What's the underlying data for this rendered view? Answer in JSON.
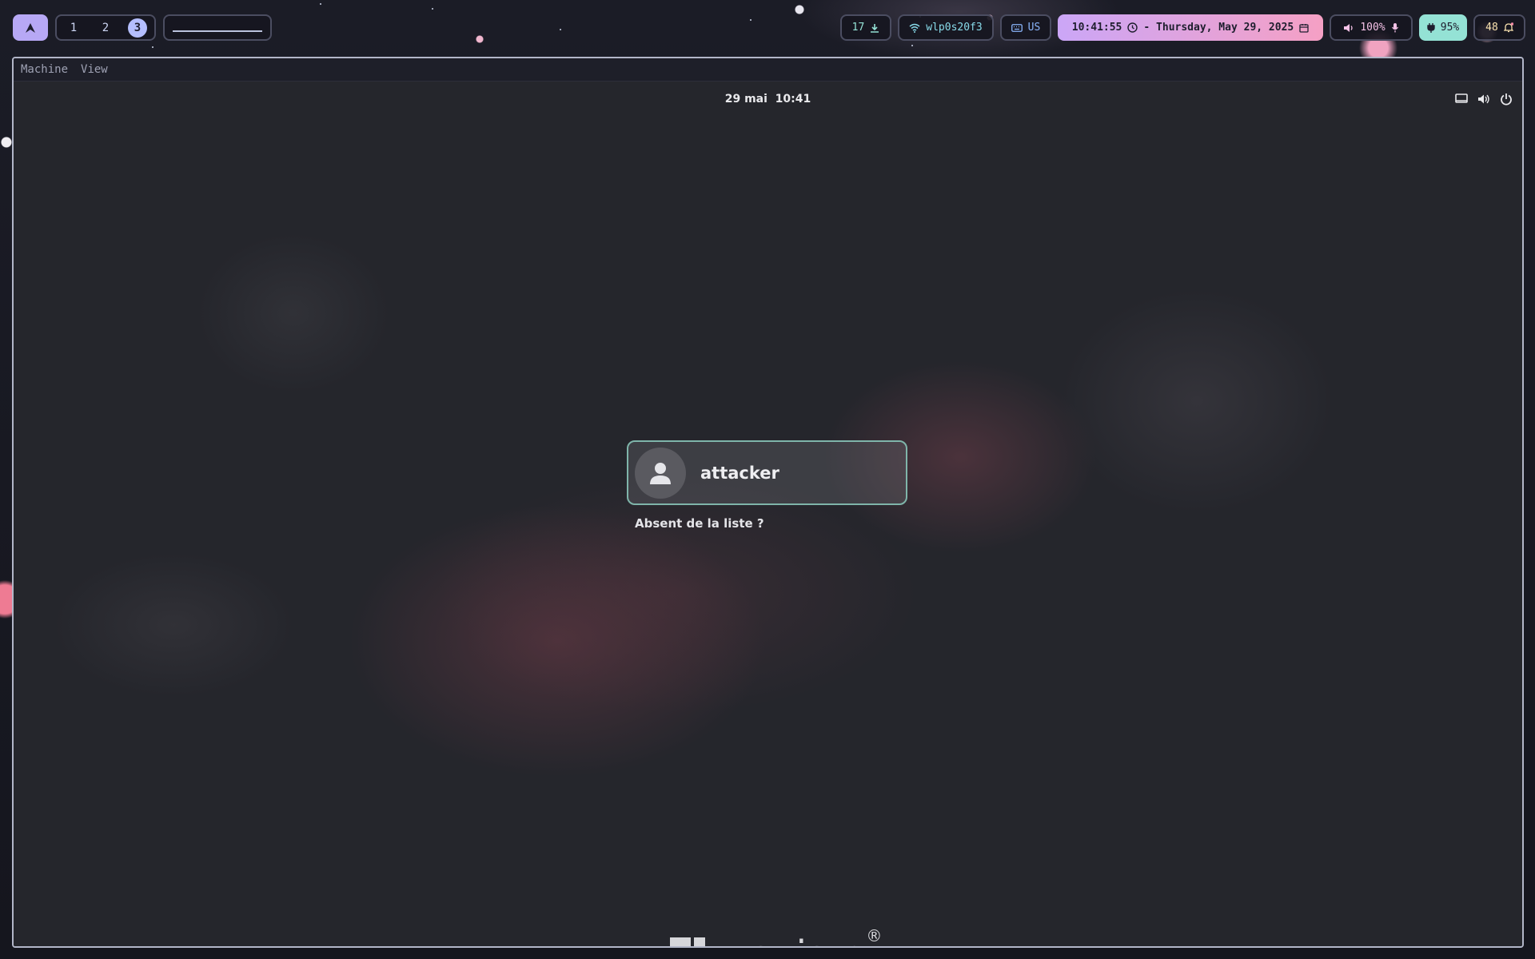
{
  "topbar": {
    "workspaces": [
      "1",
      "2",
      "3"
    ],
    "active_workspace": "3",
    "updates_count": "17",
    "wifi_interface": "wlp0s20f3",
    "keyboard_layout": "US",
    "clock": "10:41:55",
    "date": "- Thursday, May 29, 2025",
    "volume": "100%",
    "battery": "95%",
    "notifications": "48"
  },
  "vm": {
    "menu": [
      "Machine",
      "View"
    ]
  },
  "gdm": {
    "clock": "29 mai  10:41",
    "user_name": "attacker",
    "not_listed_label": "Absent de la liste ?",
    "brand": "manjaro",
    "brand_mark": "®"
  },
  "colors": {
    "accent_purple": "#b7a8f5",
    "focus_border": "#7fb5aa",
    "battery_bg": "#94e2d5"
  },
  "icons": [
    "arch-launcher-icon",
    "download-icon",
    "wifi-icon",
    "keyboard-icon",
    "clock-icon",
    "calendar-icon",
    "volume-icon",
    "mic-icon",
    "plug-icon",
    "bell-icon",
    "display-icon",
    "power-icon",
    "user-avatar-icon",
    "manjaro-logo-icon"
  ]
}
